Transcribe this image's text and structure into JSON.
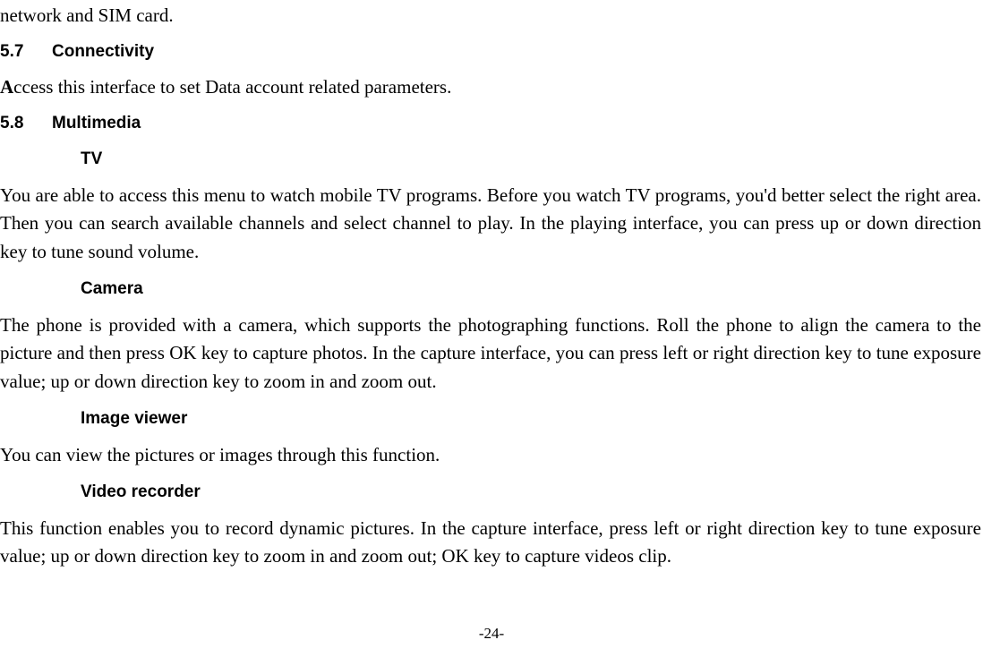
{
  "topLine": "network and SIM card.",
  "sections": {
    "connectivity": {
      "num": "5.7",
      "title": "Connectivity",
      "body_prefix_bold": "A",
      "body_rest": "ccess this interface to set Data account related parameters."
    },
    "multimedia": {
      "num": "5.8",
      "title": "Multimedia",
      "tv": {
        "title": "TV",
        "body": "You are able to access this menu to watch mobile TV programs. Before you watch TV programs, you'd better select the right area. Then you can search available channels and select channel to play. In the playing interface, you can press up or down direction key to tune sound volume."
      },
      "camera": {
        "title": "Camera",
        "body": "The phone is provided with a camera, which supports the photographing functions. Roll the phone to align the camera to the picture and then press OK key to capture photos. In the capture interface, you can press left or right direction key to tune exposure value; up or down direction key to zoom in and zoom out."
      },
      "imageViewer": {
        "title": "Image viewer",
        "body": "You can view the pictures or images through this function."
      },
      "videoRecorder": {
        "title": "Video recorder",
        "body": "This function enables you to record dynamic pictures. In the capture interface, press left or right direction key to tune exposure value; up or down direction key to zoom in and zoom out; OK key to capture videos clip."
      }
    }
  },
  "pageNumber": "-24-"
}
